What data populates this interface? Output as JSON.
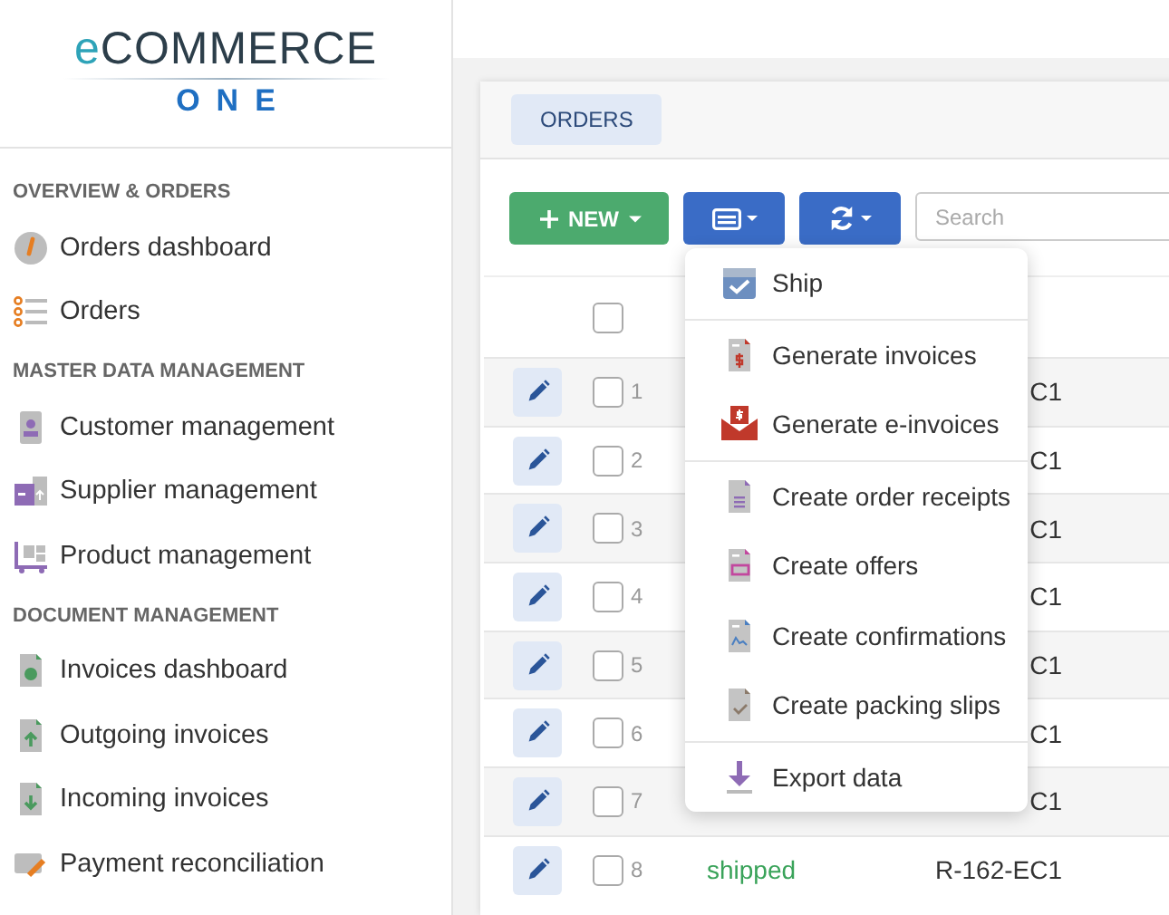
{
  "logo": {
    "prefix": "e",
    "name": "COMMERCE",
    "tagline": "ONE"
  },
  "sidebar": {
    "sections": [
      {
        "title": "OVERVIEW & ORDERS",
        "items": [
          {
            "label": "Orders dashboard"
          },
          {
            "label": "Orders"
          }
        ]
      },
      {
        "title": "MASTER DATA MANAGEMENT",
        "items": [
          {
            "label": "Customer management"
          },
          {
            "label": "Supplier management"
          },
          {
            "label": "Product management"
          }
        ]
      },
      {
        "title": "DOCUMENT MANAGEMENT",
        "items": [
          {
            "label": "Invoices dashboard"
          },
          {
            "label": "Outgoing invoices"
          },
          {
            "label": "Incoming invoices"
          },
          {
            "label": "Payment reconciliation"
          }
        ]
      }
    ]
  },
  "tabs": [
    {
      "label": "ORDERS",
      "selected": true
    }
  ],
  "toolbar": {
    "new_button": "NEW",
    "search": {
      "placeholder": "Search"
    }
  },
  "table": {
    "header_checked": false,
    "rows": [
      {
        "number": "1",
        "checked": false,
        "code": "C1"
      },
      {
        "number": "2",
        "checked": false,
        "code": "C1"
      },
      {
        "number": "3",
        "checked": false,
        "code": "C1"
      },
      {
        "number": "4",
        "checked": false,
        "code": "C1"
      },
      {
        "number": "5",
        "checked": false,
        "code": "C1"
      },
      {
        "number": "6",
        "checked": false,
        "code": "C1"
      },
      {
        "number": "7",
        "checked": false,
        "code": "C1"
      },
      {
        "number": "8",
        "checked": false,
        "status": "shipped",
        "code": "R-162-EC1"
      }
    ]
  },
  "dropdown_menu": {
    "groups": [
      [
        {
          "label": "Ship"
        }
      ],
      [
        {
          "label": "Generate invoices"
        },
        {
          "label": "Generate e-invoices"
        }
      ],
      [
        {
          "label": "Create order receipts"
        },
        {
          "label": "Create offers"
        },
        {
          "label": "Create confirmations"
        },
        {
          "label": "Create packing slips"
        }
      ],
      [
        {
          "label": "Export data"
        }
      ]
    ]
  }
}
